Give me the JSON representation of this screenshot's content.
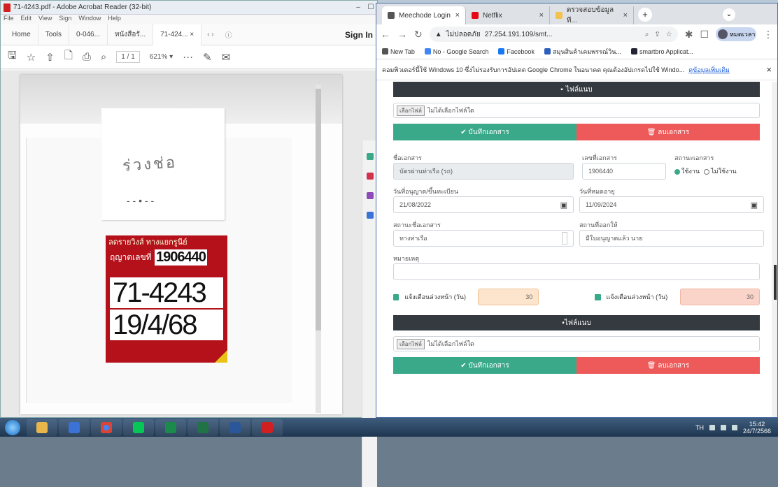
{
  "acrobat": {
    "title": "71-4243.pdf - Adobe Acrobat Reader (32-bit)",
    "menu": [
      "File",
      "Edit",
      "View",
      "Sign",
      "Window",
      "Help"
    ],
    "tabs": [
      "Home",
      "Tools",
      "0-046...",
      "หนังสือรั...",
      "71-424... ×"
    ],
    "signin": "Sign In",
    "page_indicator": "1 / 1",
    "zoom": "621% ▾",
    "scan": {
      "scribble": "ร่วงช่อ",
      "dash": "- -  •  - -",
      "sticker_header": "ลดรายวิงส์ ทางแยกรูนีย์",
      "sticker_label": "ฤญาตเลขที่",
      "sticker_number": "1906440",
      "plate": "71-4243",
      "date": "19/4/68"
    }
  },
  "chrome": {
    "tabs": [
      {
        "label": "Meechode Login",
        "color": "#555555"
      },
      {
        "label": "Netflix",
        "color": "#e50914"
      },
      {
        "label": "ตรวจสอบข้อมูลที...",
        "color": "#f2c14e"
      }
    ],
    "url_warning": "ไม่ปลอดภัย",
    "url": "27.254.191.109/smt...",
    "profile": "หมดเวลา",
    "bookmarks": [
      "New Tab",
      "No - Google Search",
      "Facebook",
      "สมุนสินค้าเคมพรรณ์วิน...",
      "smartbro Applicat..."
    ],
    "infobar_text": "คอมพิวเตอร์นี้ใช้ Windows 10 ซึ่งไม่รองรับการอัปเดต Google Chrome ในอนาคต คุณต้องอัปเกรดไปใช้ Windo...",
    "infobar_link": "ดูข้อมูลเพิ่มเติม"
  },
  "form": {
    "upload_header": "ไฟล์แนบ",
    "file_button": "เลือกไฟล์",
    "file_none": "ไม่ได้เลือกไฟล์ใด",
    "save_button": "✔ บันทึกเอกสาร",
    "delete_button": "🗑 ลบเอกสาร",
    "doc_name_label": "ชื่อเอกสาร",
    "doc_name_value": "บัตรผ่านท่าเรือ (รถ)",
    "doc_no_label": "เลขที่เอกสาร",
    "doc_no_value": "1906440",
    "status_label": "สถานะเอกสาร",
    "status_on": "ใช้งาน",
    "status_off": "ไม่ใช้งาน",
    "issue_date_label": "วันที่อนุญาต/ขึ้นทะเบียน",
    "issue_date": "21/08/2022",
    "expire_date_label": "วันที่หมดอายุ",
    "expire_date": "11/09/2024",
    "doc_type_label": "สถานะชื่อเอกสาร",
    "doc_type_value": "ทางท่าเรือ",
    "issuer_label": "สถานที่ออกให้",
    "issuer_value": "มีใบอนุญาตแล้ว นาย",
    "note_label": "หมายเหตุ",
    "note_value": "",
    "alert1_label": "แจ้งเตือนล่วงหน้า (วัน)",
    "alert1_value": "30",
    "alert2_label": "แจ้งเตือนล่วงหน้า (วัน)",
    "alert2_value": "30",
    "upload_header2": "ไฟล์แนบ",
    "save_button2": "✔ บันทึกเอกสาร",
    "delete_button2": "🗑 ลบเอกสาร"
  },
  "taskbar": {
    "lang": "TH",
    "time": "15:42",
    "date": "24/7/2566"
  }
}
